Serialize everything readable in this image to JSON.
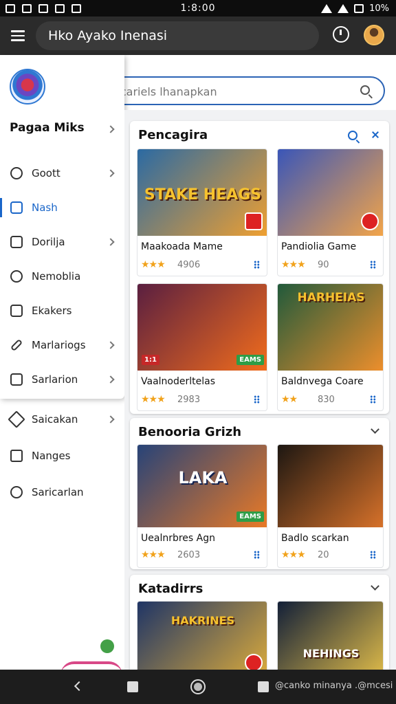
{
  "status_bar": {
    "clock": "1:8:00",
    "battery": "10%"
  },
  "app_bar": {
    "title": "Hko Ayako Inenasi"
  },
  "search": {
    "placeholder": "aplicariels lhanapkan",
    "value": ""
  },
  "drawer": {
    "header": "Pagaa Miks",
    "items": [
      {
        "label": "Goott",
        "icon": "info-icon",
        "has_chevron": true
      },
      {
        "label": "Nash",
        "icon": "grid-icon",
        "has_chevron": false,
        "active": true
      },
      {
        "label": "Dorilja",
        "icon": "document-icon",
        "has_chevron": true
      },
      {
        "label": "Nemoblia",
        "icon": "clock-icon",
        "has_chevron": false
      },
      {
        "label": "Ekakers",
        "icon": "mail-icon",
        "has_chevron": false
      },
      {
        "label": "Marlariogs",
        "icon": "pencil-icon",
        "has_chevron": true
      },
      {
        "label": "Sarlarion",
        "icon": "box-icon",
        "has_chevron": true
      }
    ]
  },
  "lower_menu": [
    {
      "label": "Saicakan",
      "icon": "heart-icon",
      "has_chevron": true
    },
    {
      "label": "Nanges",
      "icon": "edit-icon",
      "has_chevron": false
    },
    {
      "label": "Saricarlan",
      "icon": "info-icon",
      "has_chevron": false
    }
  ],
  "sections": [
    {
      "title": "Pencagira",
      "games": [
        {
          "name": "Maakoada Mame",
          "rating": 3,
          "count": "4906",
          "art_title": "STAKE HEAGS",
          "bg": [
            "#2b6aa3",
            "#f0a030"
          ]
        },
        {
          "name": "Pandiolia Game",
          "rating": 3,
          "count": "90",
          "art_title": "",
          "bg": [
            "#3a56b8",
            "#f4a548"
          ]
        },
        {
          "name": "Vaalnoderltelas",
          "rating": 3,
          "count": "2983",
          "art_title": "",
          "bg": [
            "#5a1f40",
            "#f36d1c"
          ],
          "left_badge": "1:1",
          "right_badge": "EAMS"
        },
        {
          "name": "Baldnvega Coare",
          "rating": 2,
          "count": "830",
          "art_title": "HARHEIAS",
          "bg": [
            "#215a3b",
            "#ee8f2c"
          ]
        }
      ]
    },
    {
      "title": "Benooria Grizh",
      "games": [
        {
          "name": "Uealnrbres Agn",
          "rating": 3,
          "count": "2603",
          "art_title": "LAKA",
          "bg": [
            "#274378",
            "#ea7a26"
          ],
          "right_badge": "EAMS"
        },
        {
          "name": "Badlo scarkan",
          "rating": 3,
          "count": "20",
          "art_title": "",
          "bg": [
            "#1d1712",
            "#d8722a"
          ]
        }
      ]
    },
    {
      "title": "Katadirrs",
      "games": [
        {
          "name": "",
          "rating": 0,
          "count": "",
          "art_title": "HAKRINES",
          "bg": [
            "#1f3566",
            "#e3b03a"
          ]
        },
        {
          "name": "",
          "rating": 0,
          "count": "",
          "art_title": "NEHINGS",
          "bg": [
            "#132038",
            "#e8c24a"
          ]
        }
      ]
    }
  ],
  "nav_bar": {
    "watermark": "@canko minanya .@mcesi"
  }
}
